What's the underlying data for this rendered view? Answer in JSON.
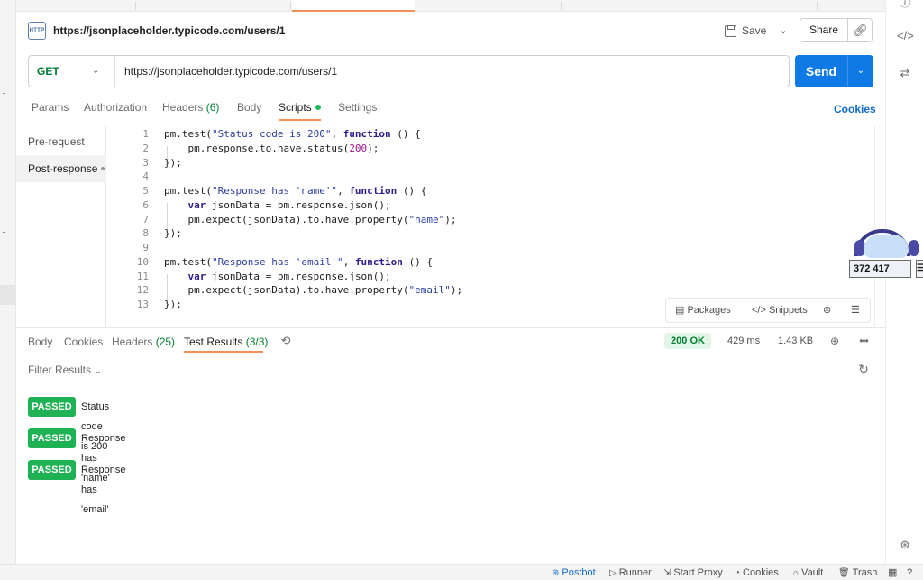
{
  "request": {
    "title": "https://jsonplaceholder.typicode.com/users/1",
    "method": "GET",
    "url": "https://jsonplaceholder.typicode.com/users/1",
    "save_label": "Save",
    "share_label": "Share",
    "send_label": "Send",
    "http_badge": "HTTP"
  },
  "request_tabs": {
    "params": "Params",
    "authorization": "Authorization",
    "headers": "Headers",
    "headers_count": "(6)",
    "body": "Body",
    "scripts": "Scripts",
    "settings": "Settings",
    "cookies": "Cookies"
  },
  "scripts": {
    "pre_request": "Pre-request",
    "post_response": "Post-response",
    "lines": [
      "pm.test(\"Status code is 200\", function () {",
      "    pm.response.to.have.status(200);",
      "});",
      "",
      "pm.test(\"Response has 'name'\", function () {",
      "    var jsonData = pm.response.json();",
      "    pm.expect(jsonData).to.have.property(\"name\");",
      "});",
      "",
      "pm.test(\"Response has 'email'\", function () {",
      "    var jsonData = pm.response.json();",
      "    pm.expect(jsonData).to.have.property(\"email\");",
      "});"
    ],
    "line_numbers": [
      "1",
      "2",
      "3",
      "4",
      "5",
      "6",
      "7",
      "8",
      "9",
      "10",
      "11",
      "12",
      "13"
    ],
    "packages": "Packages",
    "snippets": "Snippets"
  },
  "widget": {
    "count": "372 417"
  },
  "response": {
    "tabs": {
      "body": "Body",
      "cookies": "Cookies",
      "headers": "Headers",
      "headers_count": "(25)",
      "test_results": "Test Results",
      "test_results_count": "(3/3)"
    },
    "status": "200 OK",
    "time": "429 ms",
    "size": "1.43 KB",
    "filter_label": "Filter Results",
    "results": [
      {
        "status": "PASSED",
        "name": "Status code is 200"
      },
      {
        "status": "PASSED",
        "name": "Response has 'name'"
      },
      {
        "status": "PASSED",
        "name": "Response has 'email'"
      }
    ]
  },
  "footer": {
    "postbot": "Postbot",
    "runner": "Runner",
    "start_proxy": "Start Proxy",
    "cookies": "Cookies",
    "vault": "Vault",
    "trash": "Trash"
  },
  "colors": {
    "accent": "#f08f5a",
    "send": "#0f7ae5",
    "passed": "#1fb254",
    "method_get": "#007f31"
  }
}
